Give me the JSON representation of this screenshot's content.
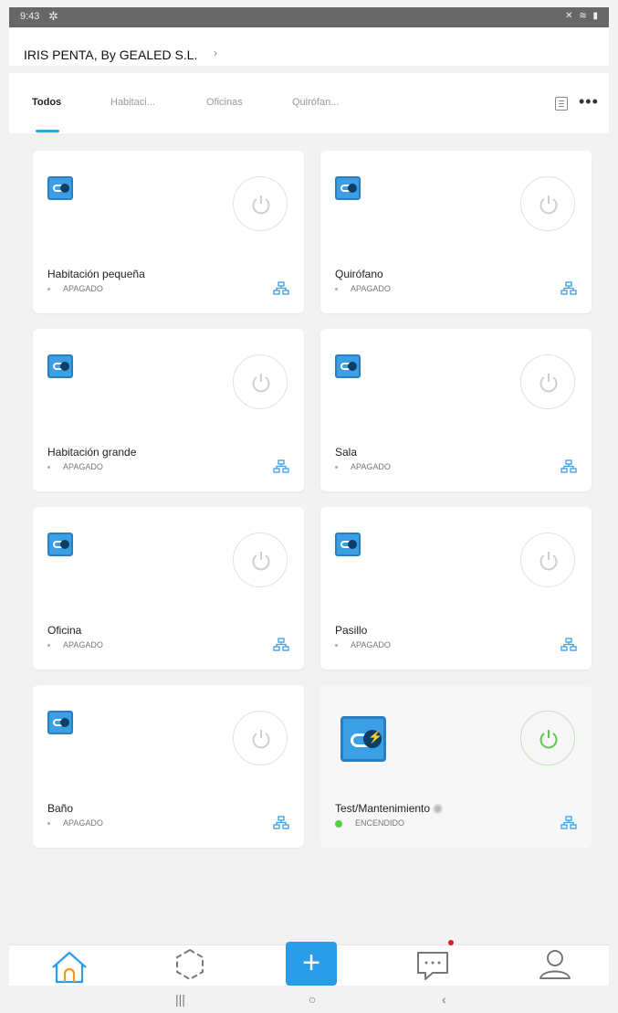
{
  "status_bar": {
    "time": "9:43"
  },
  "header": {
    "home_name": "IRIS PENTA, By GEALED S.L.",
    "chevron": "›"
  },
  "tabs": [
    {
      "label": "Todos",
      "active": true
    },
    {
      "label": "Habitaci..."
    },
    {
      "label": "Oficinas"
    },
    {
      "label": "Quirófan..."
    }
  ],
  "devices": [
    {
      "name": "Habitación pequeña",
      "status": "APAGADO",
      "on": false
    },
    {
      "name": "Quirófano",
      "status": "APAGADO",
      "on": false
    },
    {
      "name": "Habitación grande",
      "status": "APAGADO",
      "on": false
    },
    {
      "name": "Sala",
      "status": "APAGADO",
      "on": false
    },
    {
      "name": "Oficina",
      "status": "APAGADO",
      "on": false
    },
    {
      "name": "Pasillo",
      "status": "APAGADO",
      "on": false
    },
    {
      "name": "Baño",
      "status": "APAGADO",
      "on": false
    },
    {
      "name": "Test/Mantenimiento",
      "status": "ENCENDIDO",
      "on": true
    }
  ],
  "colors": {
    "accent": "#2a9de8",
    "on_green": "#5cc84c",
    "icon_blue": "#3b9fe6"
  },
  "icons": {
    "home": "home-icon",
    "scene": "scene-icon",
    "add": "plus-icon",
    "messages": "message-icon",
    "profile": "user-icon"
  }
}
